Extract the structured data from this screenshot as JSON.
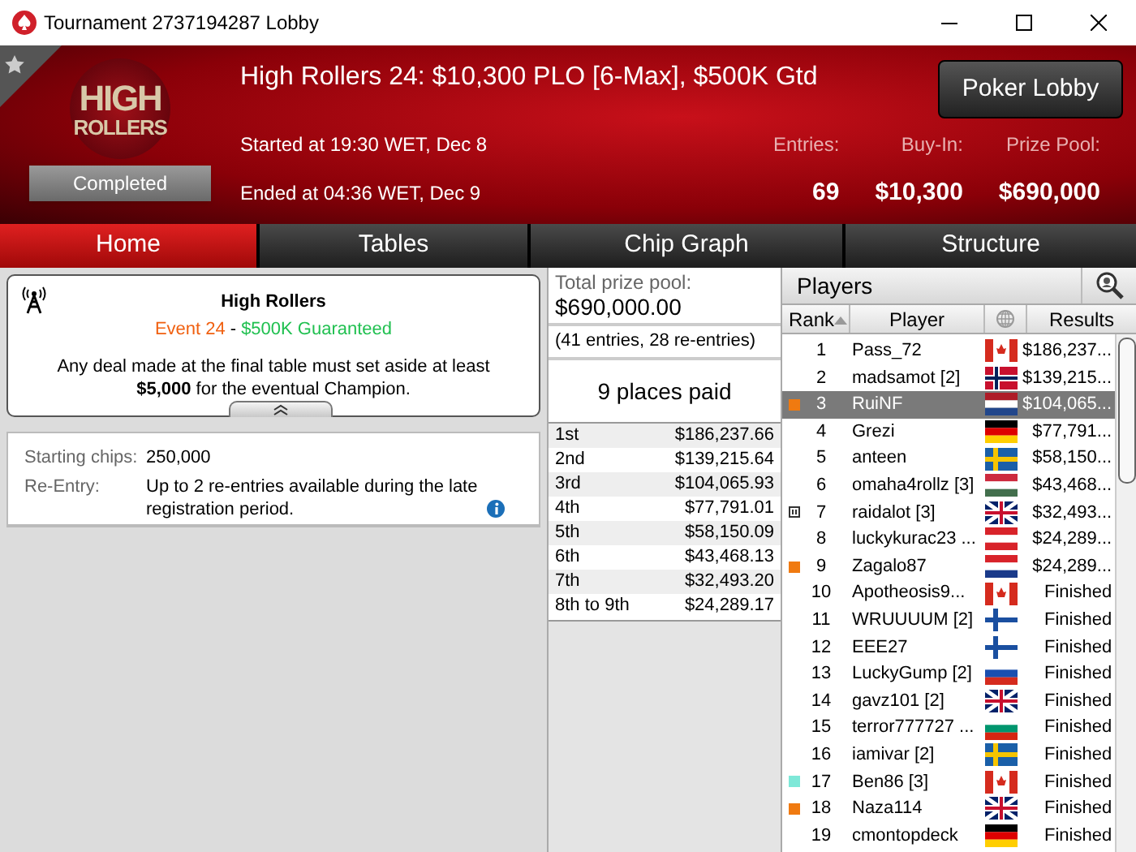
{
  "window": {
    "title": "Tournament 2737194287 Lobby"
  },
  "header": {
    "logo_top": "HIGH",
    "logo_bottom": "ROLLERS",
    "status": "Completed",
    "title": "High Rollers 24: $10,300 PLO [6-Max], $500K Gtd",
    "started": "Started at 19:30 WET, Dec 8",
    "ended": "Ended at 04:36 WET, Dec 9",
    "button": "Poker Lobby",
    "stats": [
      {
        "label": "Entries:",
        "value": "69"
      },
      {
        "label": "Buy-In:",
        "value": "$10,300"
      },
      {
        "label": "Prize Pool:",
        "value": "$690,000"
      }
    ]
  },
  "tabs": [
    {
      "label": "Home",
      "selected": true
    },
    {
      "label": "Tables",
      "selected": false
    },
    {
      "label": "Chip Graph",
      "selected": false
    },
    {
      "label": "Structure",
      "selected": false
    }
  ],
  "info": {
    "title": "High Rollers",
    "event": "Event 24",
    "separator": "-",
    "guarantee": "$500K Guaranteed",
    "note": "Any deal made at the final table must set aside at least **$5,000** for the eventual Champion.",
    "details": [
      {
        "label": "Starting chips:",
        "value": "250,000"
      },
      {
        "label": "Re-Entry:",
        "value": "Up to 2 re-entries available during the late registration period."
      }
    ]
  },
  "prizes": {
    "label": "Total prize pool:",
    "total": "$690,000.00",
    "entries": "(41 entries, 28 re-entries)",
    "paid": "9 places paid",
    "rows": [
      {
        "place": "1st",
        "amount": "$186,237.66"
      },
      {
        "place": "2nd",
        "amount": "$139,215.64"
      },
      {
        "place": "3rd",
        "amount": "$104,065.93"
      },
      {
        "place": "4th",
        "amount": "$77,791.01"
      },
      {
        "place": "5th",
        "amount": "$58,150.09"
      },
      {
        "place": "6th",
        "amount": "$43,468.13"
      },
      {
        "place": "7th",
        "amount": "$32,493.20"
      },
      {
        "place": "8th to 9th",
        "amount": "$24,289.17"
      }
    ]
  },
  "players": {
    "title": "Players",
    "columns": [
      "Rank",
      "Player",
      "Results"
    ],
    "rows": [
      {
        "rank": "1",
        "player": "Pass_72",
        "flag": {
          "kind": "ca"
        },
        "result": "$186,237...",
        "selected": false
      },
      {
        "rank": "2",
        "player": "madsamot [2]",
        "flag": {
          "kind": "no"
        },
        "result": "$139,215...",
        "selected": false
      },
      {
        "rank": "3",
        "player": "RuiNF",
        "flag": {
          "kind": "nl"
        },
        "result": "$104,065...",
        "selected": true,
        "marker": {
          "kind": "square",
          "color": "#f07a10"
        }
      },
      {
        "rank": "4",
        "player": "Grezi",
        "flag": {
          "kind": "de"
        },
        "result": "$77,791...",
        "selected": false
      },
      {
        "rank": "5",
        "player": "anteen",
        "flag": {
          "kind": "se"
        },
        "result": "$58,150...",
        "selected": false
      },
      {
        "rank": "6",
        "player": "omaha4rollz [3]",
        "flag": {
          "kind": "hu"
        },
        "result": "$43,468...",
        "selected": false
      },
      {
        "rank": "7",
        "player": "raidalot [3]",
        "flag": {
          "kind": "gb"
        },
        "result": "$32,493...",
        "selected": false,
        "marker": {
          "kind": "pause"
        }
      },
      {
        "rank": "8",
        "player": "luckykurac23 ...",
        "flag": {
          "kind": "at"
        },
        "result": "$24,289...",
        "selected": false
      },
      {
        "rank": "9",
        "player": "Zagalo87",
        "flag": {
          "kind": "hr"
        },
        "result": "$24,289...",
        "selected": false,
        "marker": {
          "kind": "square",
          "color": "#f07a10"
        }
      },
      {
        "rank": "10",
        "player": "Apotheosis9...",
        "flag": {
          "kind": "ca"
        },
        "result": "Finished",
        "selected": false
      },
      {
        "rank": "11",
        "player": "WRUUUUM [2]",
        "flag": {
          "kind": "fi"
        },
        "result": "Finished",
        "selected": false
      },
      {
        "rank": "12",
        "player": "EEE27",
        "flag": {
          "kind": "fi"
        },
        "result": "Finished",
        "selected": false
      },
      {
        "rank": "13",
        "player": "LuckyGump [2]",
        "flag": {
          "kind": "ru"
        },
        "result": "Finished",
        "selected": false
      },
      {
        "rank": "14",
        "player": "gavz101 [2]",
        "flag": {
          "kind": "gb"
        },
        "result": "Finished",
        "selected": false
      },
      {
        "rank": "15",
        "player": "terror777727 ...",
        "flag": {
          "kind": "bg"
        },
        "result": "Finished",
        "selected": false
      },
      {
        "rank": "16",
        "player": "iamivar [2]",
        "flag": {
          "kind": "se"
        },
        "result": "Finished",
        "selected": false
      },
      {
        "rank": "17",
        "player": "Ben86 [3]",
        "flag": {
          "kind": "ca"
        },
        "result": "Finished",
        "selected": false,
        "marker": {
          "kind": "square",
          "color": "#7ee8d8"
        }
      },
      {
        "rank": "18",
        "player": "Naza114",
        "flag": {
          "kind": "gb"
        },
        "result": "Finished",
        "selected": false,
        "marker": {
          "kind": "square",
          "color": "#f07a10"
        }
      },
      {
        "rank": "19",
        "player": "cmontopdeck",
        "flag": {
          "kind": "de"
        },
        "result": "Finished",
        "selected": false
      }
    ]
  }
}
